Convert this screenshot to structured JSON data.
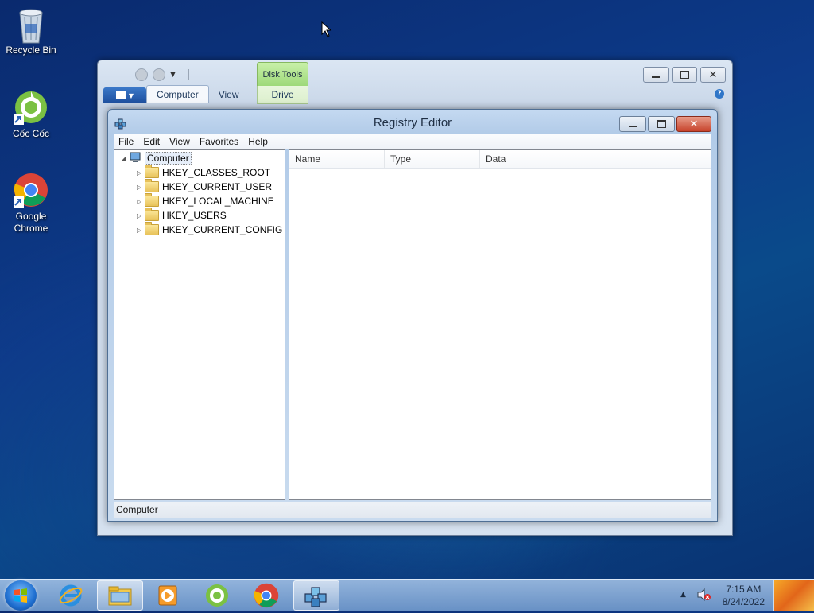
{
  "desktop": {
    "icons": [
      {
        "label": "Recycle Bin",
        "icon": "recycle-bin-icon"
      },
      {
        "label": "Cốc Cốc",
        "icon": "coccoc-icon"
      },
      {
        "label": "Google Chrome",
        "icon": "chrome-icon"
      }
    ]
  },
  "explorer": {
    "tabs": [
      "Computer",
      "View"
    ],
    "contextual_group": "Disk Tools",
    "contextual_tab": "Drive"
  },
  "regedit": {
    "title": "Registry Editor",
    "menu": [
      "File",
      "Edit",
      "View",
      "Favorites",
      "Help"
    ],
    "tree_root": "Computer",
    "tree_items": [
      "HKEY_CLASSES_ROOT",
      "HKEY_CURRENT_USER",
      "HKEY_LOCAL_MACHINE",
      "HKEY_USERS",
      "HKEY_CURRENT_CONFIG"
    ],
    "columns": [
      "Name",
      "Type",
      "Data"
    ],
    "status": "Computer"
  },
  "taskbar": {
    "items": [
      "internet-explorer-icon",
      "file-explorer-icon",
      "media-player-icon",
      "coccoc-icon",
      "chrome-icon",
      "registry-editor-icon"
    ],
    "time": "7:15 AM",
    "date": "8/24/2022"
  }
}
